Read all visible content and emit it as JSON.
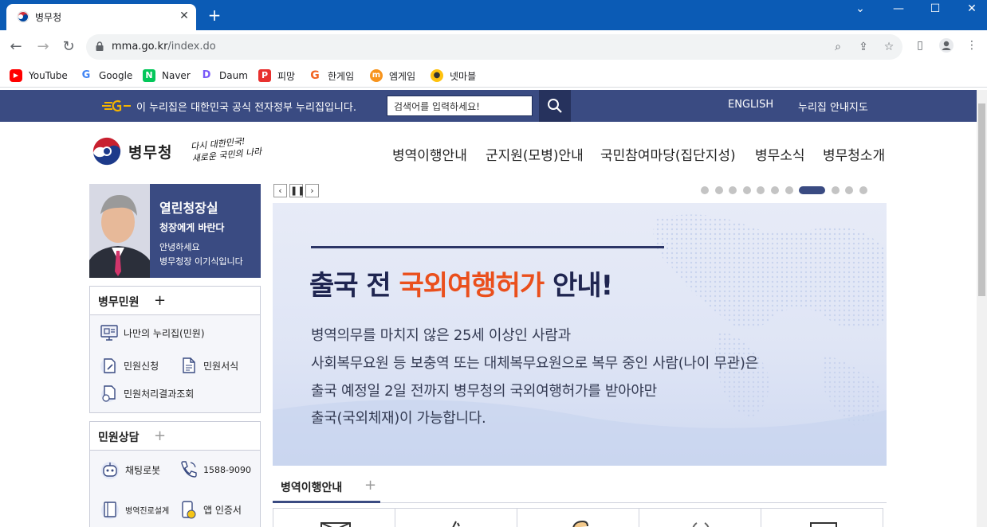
{
  "browser": {
    "tab_title": "병무청",
    "url_host": "mma.go.kr",
    "url_path": "/index.do",
    "bookmarks": [
      {
        "label": "YouTube",
        "icon": "youtube-icon",
        "color": "#ff0000"
      },
      {
        "label": "Google",
        "icon": "google-icon",
        "color": "#4285f4"
      },
      {
        "label": "Naver",
        "icon": "naver-icon",
        "color": "#03c75a"
      },
      {
        "label": "Daum",
        "icon": "daum-icon",
        "color": "#7a5af8"
      },
      {
        "label": "피망",
        "icon": "pmang-icon",
        "color": "#e8312f"
      },
      {
        "label": "한게임",
        "icon": "hangame-icon",
        "color": "#f26522"
      },
      {
        "label": "엠게임",
        "icon": "mgame-icon",
        "color": "#f7941d"
      },
      {
        "label": "넷마블",
        "icon": "netmarble-icon",
        "color": "#ffc20e"
      }
    ]
  },
  "gov_bar": {
    "notice": "이 누리집은 대한민국 공식 전자정부 누리집입니다.",
    "search_placeholder": "검색어를 입력하세요!",
    "links": [
      "ENGLISH",
      "누리집 안내지도"
    ]
  },
  "header": {
    "brand": "병무청",
    "slogan_line1": "다시 대한민국!",
    "slogan_line2": "새로운 국민의 나라",
    "nav": [
      "병역이행안내",
      "군지원(모병)안내",
      "국민참여마당(집단지성)",
      "병무소식",
      "병무청소개"
    ]
  },
  "profile": {
    "title": "열린청장실",
    "subtitle": "청장에게 바란다",
    "line1": "안녕하세요",
    "line2": "병무청장 이기식입니다"
  },
  "civil_service": {
    "title": "병무민원",
    "plus": "+",
    "items": [
      "나만의 누리집(민원)",
      "민원신청",
      "민원서식",
      "민원처리결과조회"
    ]
  },
  "consult": {
    "title": "민원상담",
    "plus": "+",
    "items": [
      "채팅로봇",
      "1588-9090",
      "병역진로설계",
      "앱 인증서"
    ]
  },
  "slider": {
    "dot_count": 11,
    "active_index": 7
  },
  "banner": {
    "headline_pre": "출국 전 ",
    "headline_highlight": "국외여행허가",
    "headline_post": " 안내!",
    "body": [
      "병역의무를 마치지 않은 25세 이상인 사람과",
      "사회복무요원 등 보충역 또는 대체복무요원으로 복무 중인 사람(나이 무관)은",
      "출국 예정일 2일 전까지 병무청의 국외여행허가를 받아야만",
      "출국(국외체재)이 가능합니다."
    ],
    "accent_color": "#ea4f1c"
  },
  "lower_tab": {
    "label": "병역이행안내",
    "plus": "+"
  },
  "colors": {
    "brand_navy": "#3a4b82",
    "chrome_blue": "#0b5bb5"
  }
}
